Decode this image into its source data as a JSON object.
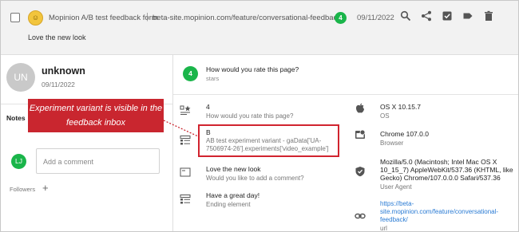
{
  "header": {
    "form_title": "Mopinion A/B test feedback form",
    "separator": "|",
    "url": "beta-site.mopinion.com/feature/conversational-feedback/",
    "score": "4",
    "date": "09/11/2022",
    "comment": "Love the new look",
    "icons": [
      "search-icon",
      "share-icon",
      "checkbox-icon",
      "tag-icon",
      "delete-icon"
    ]
  },
  "user": {
    "initials": "UN",
    "name": "unknown",
    "date": "09/11/2022"
  },
  "notes": {
    "tab_label": "Notes",
    "commenter_initials": "LJ",
    "comment_placeholder": "Add a comment",
    "followers_label": "Followers",
    "add_follower": "+"
  },
  "question": {
    "score": "4",
    "title": "How would you rate this page?",
    "type": "stars"
  },
  "answers": [
    {
      "value": "4",
      "label": "How would you rate this page?",
      "icon": "rating-icon"
    },
    {
      "value": "B",
      "label": "AB test experiment variant - gaData['UA-7506974-26'].experiments['video_example']",
      "icon": "list-icon"
    },
    {
      "value": "Love the new look",
      "label": "Would you like to add a comment?",
      "icon": "textbox-icon"
    },
    {
      "value": "Have a great day!",
      "label": "Ending element",
      "icon": "list-icon"
    }
  ],
  "meta": {
    "os": {
      "value": "OS X 10.15.7",
      "label": "OS",
      "icon": "apple-icon"
    },
    "browser": {
      "value": "Chrome 107.0.0",
      "label": "Browser",
      "icon": "browser-icon"
    },
    "user_agent": {
      "value": "Mozilla/5.0 (Macintosh; Intel Mac OS X 10_15_7) AppleWebKit/537.36 (KHTML, like Gecko) Chrome/107.0.0.0 Safari/537.36",
      "label": "User Agent",
      "icon": "shield-icon"
    },
    "url": {
      "value": "https://beta-site.mopinion.com/feature/conversational-feedback/",
      "label": "url",
      "icon": "link-icon"
    }
  },
  "annotation": {
    "text": "Experiment variant is visible in the feedback inbox",
    "color": "#c9262f"
  },
  "colors": {
    "score_green": "#1ab54a",
    "highlight_red": "#d1242f",
    "link_blue": "#2a7bd4"
  }
}
